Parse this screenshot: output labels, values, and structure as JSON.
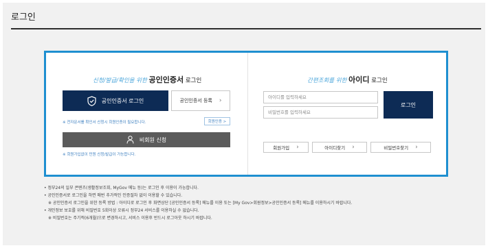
{
  "page": {
    "title": "로그인"
  },
  "cert": {
    "heading_prefix": "신청/발급/확인을 위한",
    "heading_main": "공인인증서",
    "heading_suffix": "로그인",
    "login_button": "공인인증서 로그인",
    "register_button": "공인인증서 등록",
    "notice": "※ 전자문서를 확인서 신청시 회원인증이 필요합니다.",
    "member_auth_button": "회원인증 >",
    "nonmember_button": "비회원 신청",
    "nonmember_notice": "※ 회원가입없이 민원 신청/발급이 가능합니다."
  },
  "id_login": {
    "heading_prefix": "간편조회를 위한",
    "heading_main": "아이디",
    "heading_suffix": "로그인",
    "id_placeholder": "아이디를 입력하세요",
    "pw_placeholder": "비밀번호를 입력하세요",
    "login_button": "로그인",
    "signup_button": "회원가입",
    "find_id_button": "아이디찾기",
    "find_pw_button": "비밀번호찾기"
  },
  "notes": [
    "• 정부24의 일부 콘텐츠(생활정보조회, MyGov 메뉴 등)는 로그인 후 이용이 가능합니다.",
    "• 공인인증서로 로그인을 하면 매번 추가적인 인증절차 없이 이용할 수 있습니다.",
    "※ 공인인증서 로그인을 위한 등록 방법 : 아이디로 로그인 후 화면상단 [공인인증서 등록] 메뉴를 이용 또는 [My Gov>회원정보>공인인증서 등록] 메뉴를 이용하시기 바랍니다.",
    "• 개인정보 보호를 위해 비밀번호 5회이상 오류시 정부24 서비스를 이용하실 수 없습니다.",
    "※ 비밀번호는 주기적(6개월)으로 변경하시고, 서비스 이용후 반드시 로그아웃 하시기 바랍니다."
  ],
  "colors": {
    "accent": "#1e8fd0",
    "navy": "#0d2b55",
    "gray_button": "#5b5b5b",
    "link_blue": "#3c7fc0"
  }
}
